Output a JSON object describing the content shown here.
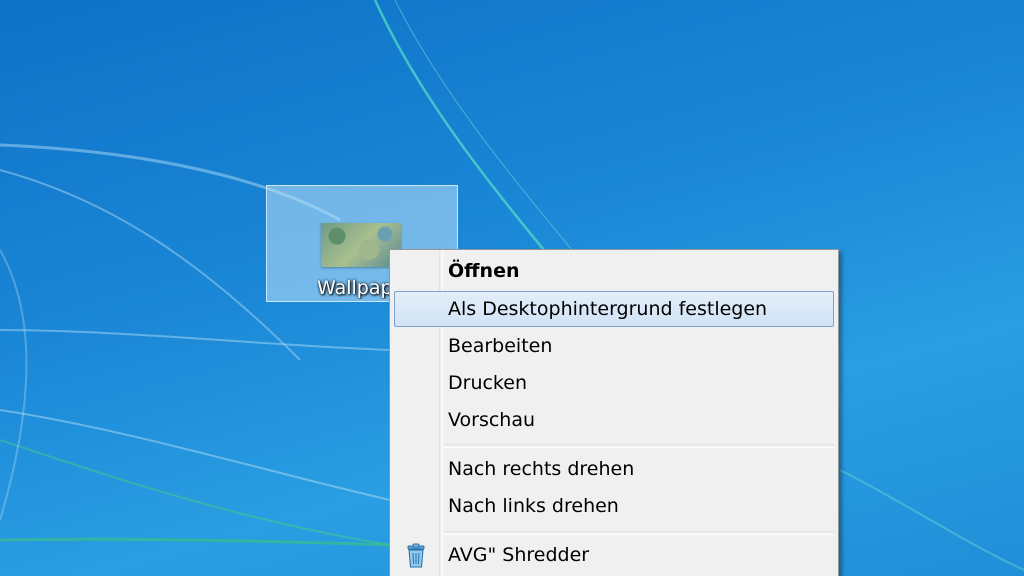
{
  "desktop": {
    "icon": {
      "label": "Wallpaper",
      "thumbnail": "landscape-image-thumbnail"
    }
  },
  "context_menu": {
    "items": [
      {
        "label": "Öffnen",
        "bold": true
      },
      {
        "label": "Als Desktophintergrund festlegen",
        "highlighted": true
      },
      {
        "label": "Bearbeiten"
      },
      {
        "label": "Drucken"
      },
      {
        "label": "Vorschau"
      },
      {
        "label": "Nach rechts drehen"
      },
      {
        "label": "Nach links drehen"
      },
      {
        "label": "AVG\" Shredder",
        "icon": "trash-shredder-icon"
      }
    ]
  },
  "colors": {
    "desktop_background": "#1a86d6",
    "menu_background": "#f0f0f0",
    "highlight_border": "#7da2ce",
    "selection_fill": "#bee1fa"
  }
}
